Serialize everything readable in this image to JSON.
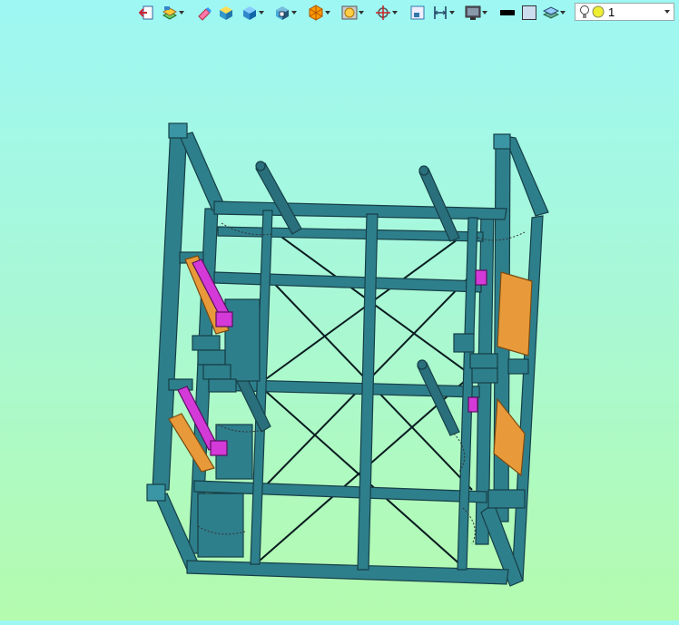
{
  "toolbar": {
    "buttons": [
      {
        "icon": "exit-icon",
        "dropdown": false
      },
      {
        "icon": "layers-icon",
        "dropdown": true
      },
      {
        "icon": "eraser-icon",
        "dropdown": false
      },
      {
        "icon": "solid-box-icon",
        "dropdown": false
      },
      {
        "icon": "box-shading-icon",
        "dropdown": true
      },
      {
        "icon": "box-view-icon",
        "dropdown": true
      },
      {
        "icon": "explode-icon",
        "dropdown": true
      },
      {
        "icon": "render-mode-icon",
        "dropdown": true
      },
      {
        "icon": "rotate-crosshair-icon",
        "dropdown": true
      },
      {
        "icon": "fit-window-icon",
        "dropdown": false
      },
      {
        "icon": "dimension-icon",
        "dropdown": true
      },
      {
        "icon": "display-mode-icon",
        "dropdown": true
      },
      {
        "icon": "line-color-icon",
        "dropdown": false
      },
      {
        "icon": "fill-color-icon",
        "dropdown": false
      },
      {
        "icon": "layer-stack-icon",
        "dropdown": true
      }
    ],
    "layer_select": {
      "value": "1",
      "icons": [
        "lightbulb-icon",
        "sun-icon"
      ]
    }
  },
  "colors": {
    "frame": "#2e7f8c",
    "frame_dark": "#163f47",
    "bracket_orange": "#e89a3a",
    "clamp_magenta": "#d43ad8",
    "bg_top": "#9ef7f3",
    "bg_bottom": "#b4fbae"
  }
}
